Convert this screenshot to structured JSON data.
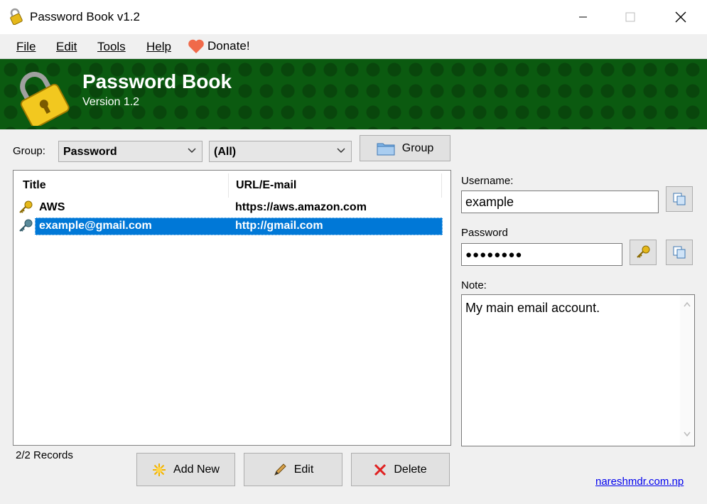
{
  "window": {
    "title": "Password Book v1.2"
  },
  "menu": {
    "file": "File",
    "edit": "Edit",
    "tools": "Tools",
    "help": "Help",
    "donate": "Donate!"
  },
  "banner": {
    "title": "Password Book",
    "version": "Version 1.2"
  },
  "group": {
    "label": "Group:",
    "selected_group": "Password",
    "selected_filter": "(All)",
    "group_button": "Group"
  },
  "list": {
    "columns": [
      "Title",
      "URL/E-mail"
    ],
    "rows": [
      {
        "title": "AWS",
        "url": "https://aws.amazon.com",
        "selected": false
      },
      {
        "title": "example@gmail.com",
        "url": "http://gmail.com",
        "selected": true
      }
    ]
  },
  "records": "2/2 Records",
  "buttons": {
    "add_new": "Add New",
    "edit": "Edit",
    "delete": "Delete"
  },
  "details": {
    "username_label": "Username:",
    "username": "example",
    "password_label": "Password",
    "password_masked": "●●●●●●●●",
    "note_label": "Note:",
    "note": "My main email account."
  },
  "footer_link": "nareshmdr.com.np",
  "colors": {
    "banner": "#0b5a10",
    "selection": "#0078d7",
    "accent_gold": "#e5b81a"
  },
  "icons": [
    "lock-icon",
    "minimize-icon",
    "maximize-icon",
    "close-icon",
    "heart-icon",
    "folder-icon",
    "key-icon",
    "copy-icon",
    "star-icon",
    "pencil-icon",
    "delete-x-icon",
    "chevron-down-icon",
    "chevron-up-icon"
  ]
}
